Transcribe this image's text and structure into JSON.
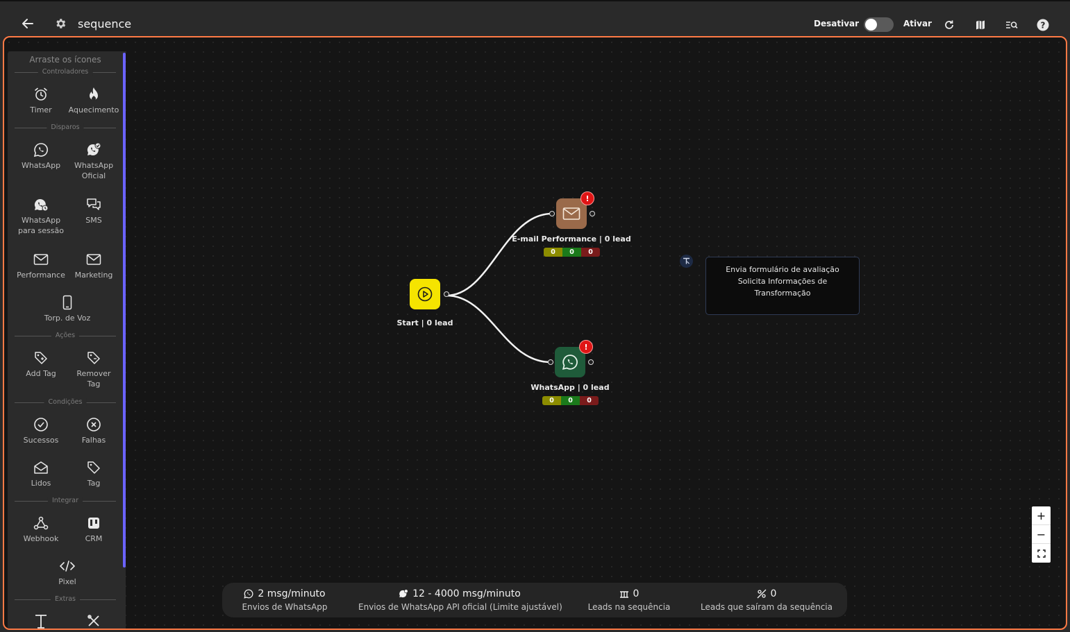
{
  "header": {
    "title": "sequence",
    "deactivate_label": "Desativar",
    "activate_label": "Ativar",
    "toggle_state": "off"
  },
  "palette": {
    "hint": "Arraste os ícones",
    "sections": {
      "controllers": "Controladores",
      "dispatches": "Disparos",
      "actions": "Ações",
      "conditions": "Condições",
      "integrate": "Integrar",
      "extras": "Extras"
    },
    "items": {
      "timer": "Timer",
      "warmup": "Aquecimento",
      "whatsapp": "WhatsApp",
      "whatsapp_official_1": "WhatsApp",
      "whatsapp_official_2": "Oficial",
      "whatsapp_session_1": "WhatsApp",
      "whatsapp_session_2": "para sessão",
      "sms": "SMS",
      "performance": "Performance",
      "marketing": "Marketing",
      "voice": "Torp. de Voz",
      "add_tag": "Add Tag",
      "remove_tag_1": "Remover",
      "remove_tag_2": "Tag",
      "success": "Sucessos",
      "failures": "Falhas",
      "read": "Lidos",
      "tag": "Tag",
      "webhook": "Webhook",
      "crm": "CRM",
      "pixel": "Pixel"
    }
  },
  "flow": {
    "start_label": "Start | 0 lead",
    "email_label": "E-mail Performance | 0 lead",
    "email_stats": [
      "0",
      "0",
      "0"
    ],
    "email_alert": "!",
    "whatsapp_label": "WhatsApp | 0 lead",
    "whatsapp_stats": [
      "0",
      "0",
      "0"
    ],
    "whatsapp_alert": "!",
    "note_lines": [
      "Envia formulário de avaliação",
      "Solicita Informações de",
      "Transformação"
    ]
  },
  "zoom": {
    "in": "+",
    "out": "−"
  },
  "footer": {
    "wa_value": "2 msg/minuto",
    "wa_label": "Envios de WhatsApp",
    "api_value": "12 - 4000 msg/minuto",
    "api_label": "Envios de WhatsApp API oficial (Limite ajustável)",
    "leads_in_value": "0",
    "leads_in_label": "Leads na sequência",
    "leads_out_value": "0",
    "leads_out_label": "Leads que saíram da sequência"
  },
  "colors": {
    "accent_border": "#ff7a45",
    "start_node": "#f5e400",
    "email_node": "#9a6a4a",
    "whatsapp_node": "#1f5b3a",
    "stat_yellow": "#8c8c00",
    "stat_green": "#1b7a1b",
    "stat_red": "#7a1b1b",
    "scrollbar": "#6b63ff"
  }
}
